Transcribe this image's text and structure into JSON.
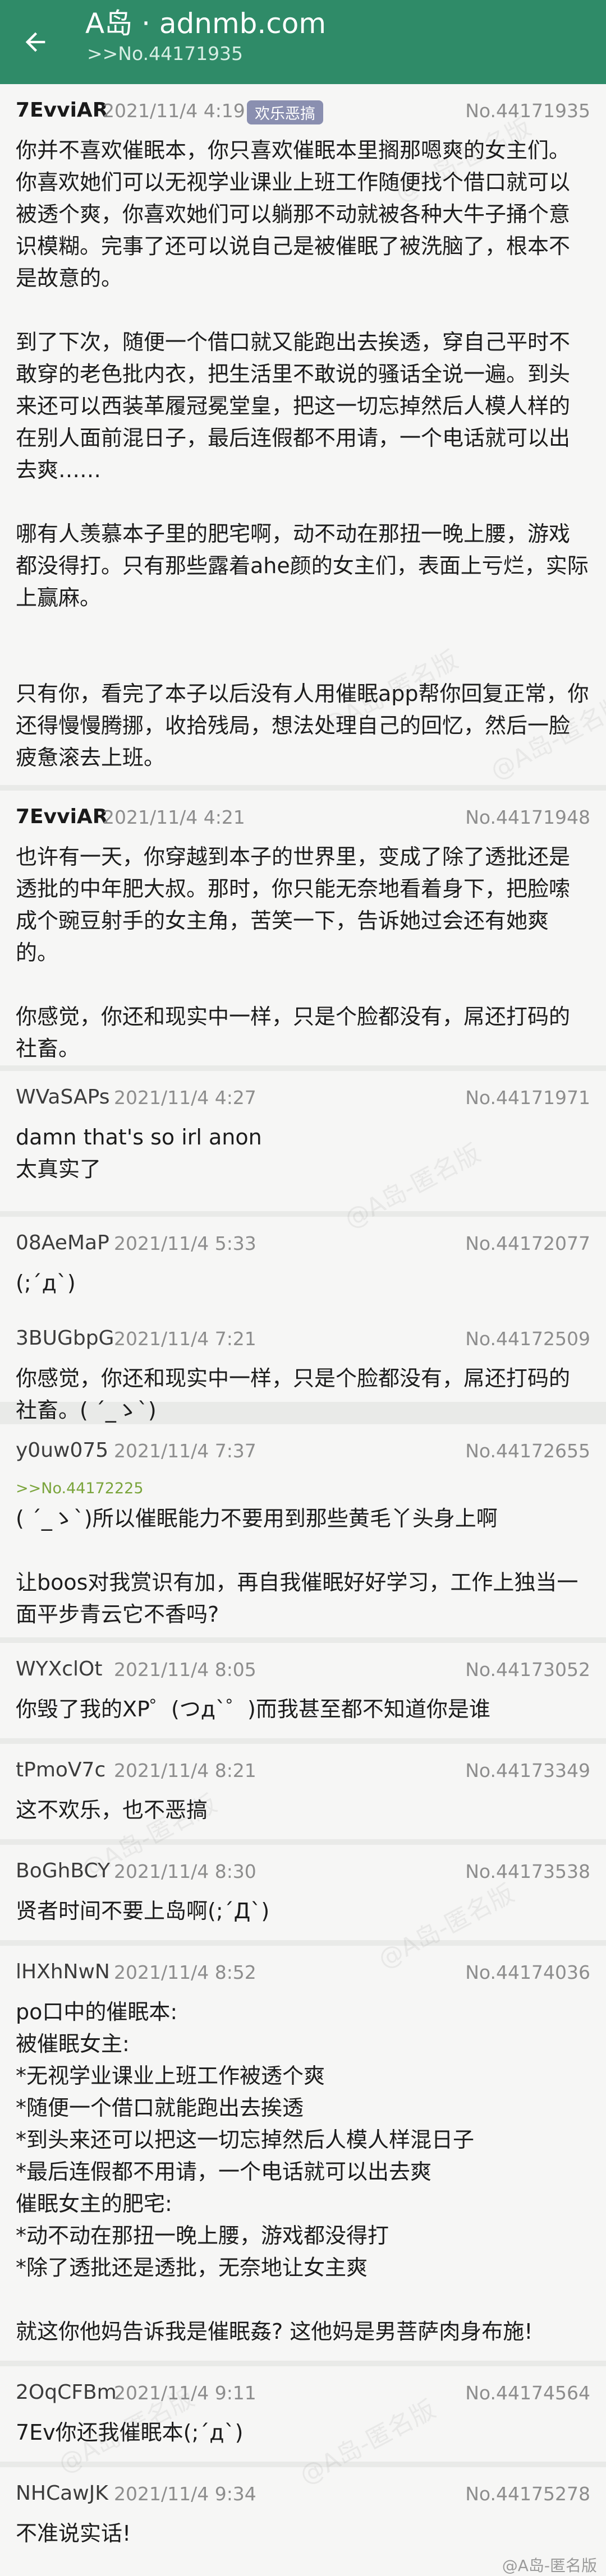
{
  "header": {
    "title": "A岛 · adnmb.com",
    "subtitle": ">>No.44171935",
    "back_icon": "arrow-left-icon"
  },
  "posts": [
    {
      "uid": "7EvviAR",
      "time": "2021/11/4 4:19",
      "tag": "欢乐恶搞",
      "no": "No.44171935",
      "text": "你并不喜欢催眠本，你只喜欢催眠本里搁那嗯爽的女主们。你喜欢她们可以无视学业课业上班工作随便找个借口就可以被透个爽，你喜欢她们可以躺那不动就被各种大牛子捅个意识模糊。完事了还可以说自己是被催眠了被洗脑了，根本不是故意的。\n\n到了下次，随便一个借口就又能跑出去挨透，穿自己平时不敢穿的老色批内衣，把生活里不敢说的骚话全说一遍。到头来还可以西装革履冠冕堂皇，把这一切忘掉然后人模人样的在别人面前混日子，最后连假都不用请，一个电话就可以出去爽……\n\n哪有人羡慕本子里的肥宅啊，动不动在那扭一晚上腰，游戏都没得打。只有那些露着ahe颜的女主们，表面上亏烂，实际上赢麻。\n\n\n只有你，看完了本子以后没有人用催眠app帮你回复正常，你还得慢慢腾挪，收拾残局，想法处理自己的回忆，然后一脸疲惫滚去上班。"
    },
    {
      "uid": "7EvviAR",
      "time": "2021/11/4 4:21",
      "no": "No.44171948",
      "text": "也许有一天，你穿越到本子的世界里，变成了除了透批还是透批的中年肥大叔。那时，你只能无奈地看着身下，把脸嗦成个豌豆射手的女主角，苦笑一下，告诉她过会还有她爽的。\n\n你感觉，你还和现实中一样，只是个脸都没有，屌还打码的社畜。"
    },
    {
      "uid": "WVaSAPs",
      "time": "2021/11/4 4:27",
      "no": "No.44171971",
      "text": "damn that's so irl anon\n太真实了"
    },
    {
      "uid": "08AeMaP",
      "time": "2021/11/4 5:33",
      "no": "No.44172077",
      "text": "(;´д`)"
    },
    {
      "uid": "3BUGbpG",
      "time": "2021/11/4 7:21",
      "no": "No.44172509",
      "text": "你感觉，你还和现实中一样，只是个脸都没有，屌还打码的社畜。( ´_ゝ`)"
    },
    {
      "uid": "y0uw075",
      "time": "2021/11/4 7:37",
      "no": "No.44172655",
      "ref": ">>No.44172225",
      "text": "( ´_ゝ`)所以催眠能力不要用到那些黄毛丫头身上啊\n\n让boos对我赏识有加，再自我催眠好好学习，工作上独当一面平步青云它不香吗?"
    },
    {
      "uid": "WYXclOt",
      "time": "2021/11/4 8:05",
      "no": "No.44173052",
      "text": "你毁了我的XP゜(つд`゜)而我甚至都不知道你是谁"
    },
    {
      "uid": "tPmoV7c",
      "time": "2021/11/4 8:21",
      "no": "No.44173349",
      "text": "这不欢乐，也不恶搞"
    },
    {
      "uid": "BoGhBCY",
      "time": "2021/11/4 8:30",
      "no": "No.44173538",
      "text": "贤者时间不要上岛啊(;´Д`)"
    },
    {
      "uid": "lHXhNwN",
      "time": "2021/11/4 8:52",
      "no": "No.44174036",
      "text": "po口中的催眠本:\n被催眠女主:\n*无视学业课业上班工作被透个爽\n*随便一个借口就能跑出去挨透\n*到头来还可以把这一切忘掉然后人模人样混日子\n*最后连假都不用请，一个电话就可以出去爽\n催眠女主的肥宅:\n*动不动在那扭一晚上腰，游戏都没得打\n*除了透批还是透批，无奈地让女主爽\n\n就这你他妈告诉我是催眠姦? 这他妈是男菩萨肉身布施!"
    },
    {
      "uid": "2OqCFBm",
      "time": "2021/11/4 9:11",
      "no": "No.44174564",
      "text": "7Ev你还我催眠本(;´д`)"
    },
    {
      "uid": "NHCawJK",
      "time": "2021/11/4 9:34",
      "no": "No.44175278",
      "text": "不准说实话!"
    }
  ],
  "watermarks": [
    "@A岛-匿名版",
    "@A岛-匿名版",
    "@A岛-匿名版",
    "@A岛-匿名版",
    "@A岛-匿名版",
    "@A岛-匿名版",
    "@A岛-匿名版",
    "@A岛-匿名版"
  ],
  "corner_mark": "@A岛-匿名版",
  "colors": {
    "appbar": "#2f8b68",
    "tag_background": "#8a8fb0",
    "reference_link": "#7aa43b"
  }
}
